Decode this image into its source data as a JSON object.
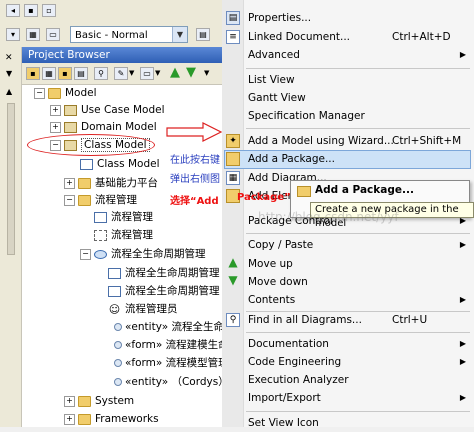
{
  "toolbar": {
    "perspective_value": "Basic - Normal"
  },
  "project_browser": {
    "title": "Project Browser",
    "tree": [
      {
        "label": "Model",
        "icon": "folder",
        "expanded": true
      },
      {
        "label": "Use Case Model",
        "icon": "package",
        "expanded": false
      },
      {
        "label": "Domain Model",
        "icon": "package",
        "expanded": false
      },
      {
        "label": "Class Model",
        "icon": "package",
        "expanded": true
      },
      {
        "label": "Class Model",
        "icon": "class-diagram"
      },
      {
        "label": "基础能力平台",
        "icon": "folder",
        "expanded": false
      },
      {
        "label": "流程管理",
        "icon": "folder",
        "expanded": true
      },
      {
        "label": "流程管理",
        "icon": "class-diagram"
      },
      {
        "label": "流程管理",
        "icon": "activity-diagram"
      },
      {
        "label": "流程全生命周期管理",
        "icon": "use-case",
        "expanded": true
      },
      {
        "label": "流程全生命周期管理",
        "icon": "class-diagram"
      },
      {
        "label": "流程全生命周期管理",
        "icon": "class-diagram"
      },
      {
        "label": "流程管理员",
        "icon": "actor"
      },
      {
        "label": "«entity» 流程全生命",
        "icon": "entity"
      },
      {
        "label": "«form» 流程建模生命",
        "icon": "entity"
      },
      {
        "label": "«form» 流程模型管理",
        "icon": "entity"
      },
      {
        "label": "«entity» （Cordys）",
        "icon": "entity"
      },
      {
        "label": "System",
        "icon": "folder",
        "expanded": false
      },
      {
        "label": "Frameworks",
        "icon": "folder",
        "expanded": false
      }
    ]
  },
  "annotations": {
    "line1": "在此按右键",
    "line2": "弹出右侧图",
    "line3_prefix": "选择“Add",
    "line3_suffix": "Package”"
  },
  "context_menu": {
    "items": [
      {
        "label": "Properties...",
        "shortcut": "",
        "submenu": false,
        "icon": "properties-icon"
      },
      {
        "label": "Linked Document...",
        "shortcut": "Ctrl+Alt+D",
        "submenu": false,
        "icon": "linked-document-icon"
      },
      {
        "label": "Advanced",
        "shortcut": "",
        "submenu": true,
        "icon": ""
      },
      {
        "label": "List View",
        "shortcut": "",
        "submenu": false,
        "icon": ""
      },
      {
        "label": "Gantt View",
        "shortcut": "",
        "submenu": false,
        "icon": ""
      },
      {
        "label": "Specification Manager",
        "shortcut": "",
        "submenu": false,
        "icon": ""
      },
      {
        "label": "Add a Model using Wizard...",
        "shortcut": "Ctrl+Shift+M",
        "submenu": false,
        "icon": "wizard-icon"
      },
      {
        "label": "Add a Package...",
        "shortcut": "",
        "submenu": false,
        "icon": "package-icon"
      },
      {
        "label": "Add Diagram...",
        "shortcut": "",
        "submenu": false,
        "icon": "diagram-icon"
      },
      {
        "label": "Add Element...",
        "shortcut": "",
        "submenu": false,
        "icon": "element-icon"
      },
      {
        "label": "Package Control",
        "shortcut": "",
        "submenu": true,
        "icon": ""
      },
      {
        "label": "Copy / Paste",
        "shortcut": "",
        "submenu": true,
        "icon": ""
      },
      {
        "label": "Move up",
        "shortcut": "",
        "submenu": false,
        "icon": "arrow-up-icon"
      },
      {
        "label": "Move down",
        "shortcut": "",
        "submenu": false,
        "icon": "arrow-down-icon"
      },
      {
        "label": "Contents",
        "shortcut": "",
        "submenu": true,
        "icon": ""
      },
      {
        "label": "Find in all Diagrams...",
        "shortcut": "Ctrl+U",
        "submenu": false,
        "icon": "find-icon"
      },
      {
        "label": "Documentation",
        "shortcut": "",
        "submenu": true,
        "icon": ""
      },
      {
        "label": "Code Engineering",
        "shortcut": "",
        "submenu": true,
        "icon": ""
      },
      {
        "label": "Execution Analyzer",
        "shortcut": "",
        "submenu": false,
        "icon": ""
      },
      {
        "label": "Import/Export",
        "shortcut": "",
        "submenu": true,
        "icon": ""
      },
      {
        "label": "Set View Icon",
        "shortcut": "",
        "submenu": false,
        "icon": ""
      }
    ]
  },
  "submenu_tooltip": {
    "title": "Add a Package...",
    "description": "Create a new package in the model"
  },
  "watermark": "http://blog.csdn.net/yyf"
}
